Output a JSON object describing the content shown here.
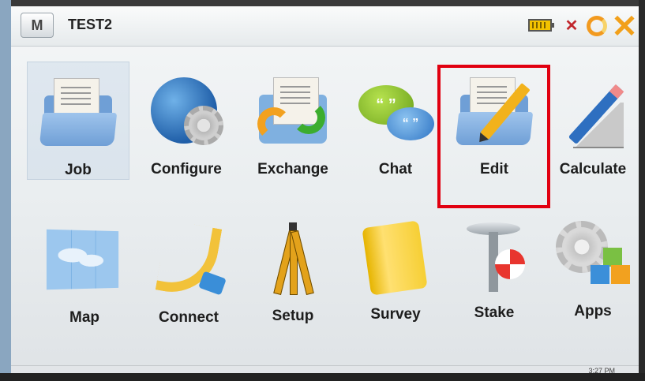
{
  "window": {
    "menu_button": "M",
    "title": "TEST2"
  },
  "status": {
    "battery_icon": "battery-icon",
    "mail_icon": "no-mail-icon",
    "sync_icon": "sync-icon",
    "close_icon": "close-icon"
  },
  "highlight_color": "#e10010",
  "apps": [
    {
      "label": "Job",
      "icon": "job-folder-icon"
    },
    {
      "label": "Configure",
      "icon": "globe-gear-icon"
    },
    {
      "label": "Exchange",
      "icon": "exchange-arrows-icon"
    },
    {
      "label": "Chat",
      "icon": "chat-bubbles-icon"
    },
    {
      "label": "Edit",
      "icon": "edit-folder-pencil-icon"
    },
    {
      "label": "Calculate",
      "icon": "calculate-ruler-pen-icon"
    },
    {
      "label": "Map",
      "icon": "map-icon"
    },
    {
      "label": "Connect",
      "icon": "cable-icon"
    },
    {
      "label": "Setup",
      "icon": "tripod-icon"
    },
    {
      "label": "Survey",
      "icon": "notebook-icon"
    },
    {
      "label": "Stake",
      "icon": "stake-icon"
    },
    {
      "label": "Apps",
      "icon": "apps-gear-icon"
    }
  ],
  "taskbar": {
    "clock": "3:27 PM"
  }
}
